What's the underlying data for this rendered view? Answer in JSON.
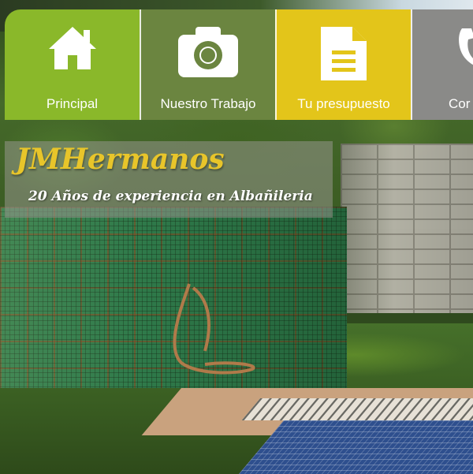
{
  "nav": {
    "items": [
      {
        "label": "Principal",
        "icon": "home-icon",
        "color": "#8ab82a"
      },
      {
        "label": "Nuestro Trabajo",
        "icon": "camera-icon",
        "color": "#6b8540"
      },
      {
        "label": "Tu presupuesto",
        "icon": "document-icon",
        "color": "#e3c51a"
      },
      {
        "label": "Cor",
        "icon": "phone-icon",
        "color": "#8a8a88"
      }
    ]
  },
  "brand": {
    "title": "JMHermanos",
    "subtitle": "20 Años de experiencia en Albañileria",
    "title_color": "#e8c52a"
  }
}
